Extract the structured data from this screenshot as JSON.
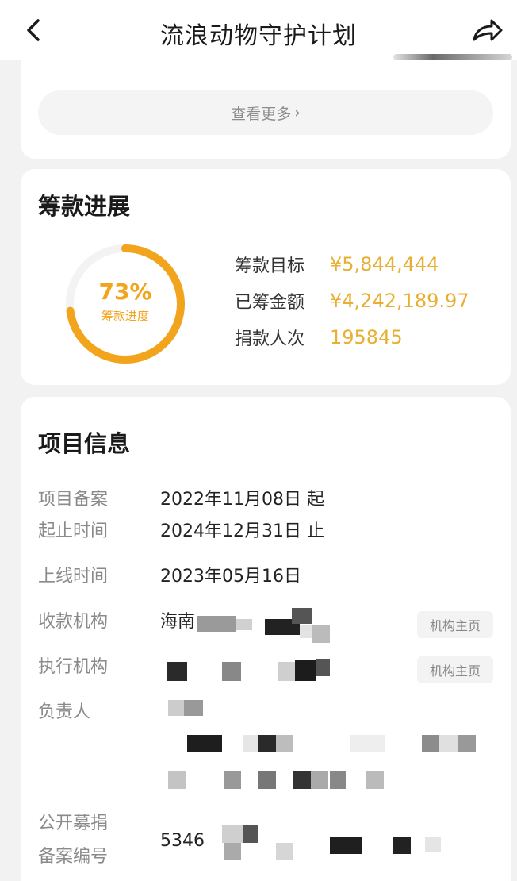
{
  "header": {
    "title": "流浪动物守护计划",
    "back_icon": "chevron-left-icon",
    "share_icon": "share-arrow-icon"
  },
  "more_section": {
    "more_label": "查看更多",
    "chevron": "›"
  },
  "fundraising": {
    "section_title": "筹款进展",
    "progress_percent": "73%",
    "progress_value": 0.73,
    "progress_label": "筹款进度",
    "target_label": "筹款目标",
    "target_value": "¥5,844,444",
    "raised_label": "已筹金额",
    "raised_value": "¥4,242,189.97",
    "donors_label": "捐款人次",
    "donors_value": "195845",
    "accent_color": "#f2a41c"
  },
  "project_info": {
    "section_title": "项目信息",
    "record_label_1": "项目备案",
    "record_label_2": "起止时间",
    "record_start": "2022年11月08日 起",
    "record_end": "2024年12月31日 止",
    "online_label": "上线时间",
    "online_value": "2023年05月16日",
    "receiver_label": "收款机构",
    "receiver_value": "海南",
    "executor_label": "执行机构",
    "org_home_label": "机构主页",
    "person_label": "负责人",
    "public_label_1": "公开募捐",
    "public_label_2": "备案编号",
    "public_value": "5346"
  }
}
